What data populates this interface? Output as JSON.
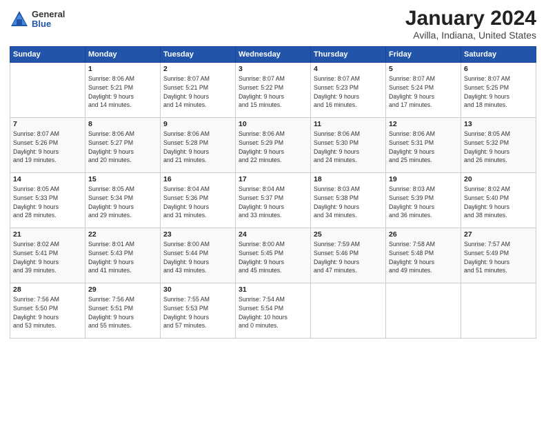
{
  "header": {
    "logo_general": "General",
    "logo_blue": "Blue",
    "title": "January 2024",
    "subtitle": "Avilla, Indiana, United States"
  },
  "calendar": {
    "weekdays": [
      "Sunday",
      "Monday",
      "Tuesday",
      "Wednesday",
      "Thursday",
      "Friday",
      "Saturday"
    ],
    "weeks": [
      [
        {
          "day": "",
          "info": ""
        },
        {
          "day": "1",
          "info": "Sunrise: 8:06 AM\nSunset: 5:21 PM\nDaylight: 9 hours\nand 14 minutes."
        },
        {
          "day": "2",
          "info": "Sunrise: 8:07 AM\nSunset: 5:21 PM\nDaylight: 9 hours\nand 14 minutes."
        },
        {
          "day": "3",
          "info": "Sunrise: 8:07 AM\nSunset: 5:22 PM\nDaylight: 9 hours\nand 15 minutes."
        },
        {
          "day": "4",
          "info": "Sunrise: 8:07 AM\nSunset: 5:23 PM\nDaylight: 9 hours\nand 16 minutes."
        },
        {
          "day": "5",
          "info": "Sunrise: 8:07 AM\nSunset: 5:24 PM\nDaylight: 9 hours\nand 17 minutes."
        },
        {
          "day": "6",
          "info": "Sunrise: 8:07 AM\nSunset: 5:25 PM\nDaylight: 9 hours\nand 18 minutes."
        }
      ],
      [
        {
          "day": "7",
          "info": "Sunrise: 8:07 AM\nSunset: 5:26 PM\nDaylight: 9 hours\nand 19 minutes."
        },
        {
          "day": "8",
          "info": "Sunrise: 8:06 AM\nSunset: 5:27 PM\nDaylight: 9 hours\nand 20 minutes."
        },
        {
          "day": "9",
          "info": "Sunrise: 8:06 AM\nSunset: 5:28 PM\nDaylight: 9 hours\nand 21 minutes."
        },
        {
          "day": "10",
          "info": "Sunrise: 8:06 AM\nSunset: 5:29 PM\nDaylight: 9 hours\nand 22 minutes."
        },
        {
          "day": "11",
          "info": "Sunrise: 8:06 AM\nSunset: 5:30 PM\nDaylight: 9 hours\nand 24 minutes."
        },
        {
          "day": "12",
          "info": "Sunrise: 8:06 AM\nSunset: 5:31 PM\nDaylight: 9 hours\nand 25 minutes."
        },
        {
          "day": "13",
          "info": "Sunrise: 8:05 AM\nSunset: 5:32 PM\nDaylight: 9 hours\nand 26 minutes."
        }
      ],
      [
        {
          "day": "14",
          "info": "Sunrise: 8:05 AM\nSunset: 5:33 PM\nDaylight: 9 hours\nand 28 minutes."
        },
        {
          "day": "15",
          "info": "Sunrise: 8:05 AM\nSunset: 5:34 PM\nDaylight: 9 hours\nand 29 minutes."
        },
        {
          "day": "16",
          "info": "Sunrise: 8:04 AM\nSunset: 5:36 PM\nDaylight: 9 hours\nand 31 minutes."
        },
        {
          "day": "17",
          "info": "Sunrise: 8:04 AM\nSunset: 5:37 PM\nDaylight: 9 hours\nand 33 minutes."
        },
        {
          "day": "18",
          "info": "Sunrise: 8:03 AM\nSunset: 5:38 PM\nDaylight: 9 hours\nand 34 minutes."
        },
        {
          "day": "19",
          "info": "Sunrise: 8:03 AM\nSunset: 5:39 PM\nDaylight: 9 hours\nand 36 minutes."
        },
        {
          "day": "20",
          "info": "Sunrise: 8:02 AM\nSunset: 5:40 PM\nDaylight: 9 hours\nand 38 minutes."
        }
      ],
      [
        {
          "day": "21",
          "info": "Sunrise: 8:02 AM\nSunset: 5:41 PM\nDaylight: 9 hours\nand 39 minutes."
        },
        {
          "day": "22",
          "info": "Sunrise: 8:01 AM\nSunset: 5:43 PM\nDaylight: 9 hours\nand 41 minutes."
        },
        {
          "day": "23",
          "info": "Sunrise: 8:00 AM\nSunset: 5:44 PM\nDaylight: 9 hours\nand 43 minutes."
        },
        {
          "day": "24",
          "info": "Sunrise: 8:00 AM\nSunset: 5:45 PM\nDaylight: 9 hours\nand 45 minutes."
        },
        {
          "day": "25",
          "info": "Sunrise: 7:59 AM\nSunset: 5:46 PM\nDaylight: 9 hours\nand 47 minutes."
        },
        {
          "day": "26",
          "info": "Sunrise: 7:58 AM\nSunset: 5:48 PM\nDaylight: 9 hours\nand 49 minutes."
        },
        {
          "day": "27",
          "info": "Sunrise: 7:57 AM\nSunset: 5:49 PM\nDaylight: 9 hours\nand 51 minutes."
        }
      ],
      [
        {
          "day": "28",
          "info": "Sunrise: 7:56 AM\nSunset: 5:50 PM\nDaylight: 9 hours\nand 53 minutes."
        },
        {
          "day": "29",
          "info": "Sunrise: 7:56 AM\nSunset: 5:51 PM\nDaylight: 9 hours\nand 55 minutes."
        },
        {
          "day": "30",
          "info": "Sunrise: 7:55 AM\nSunset: 5:53 PM\nDaylight: 9 hours\nand 57 minutes."
        },
        {
          "day": "31",
          "info": "Sunrise: 7:54 AM\nSunset: 5:54 PM\nDaylight: 10 hours\nand 0 minutes."
        },
        {
          "day": "",
          "info": ""
        },
        {
          "day": "",
          "info": ""
        },
        {
          "day": "",
          "info": ""
        }
      ]
    ]
  }
}
